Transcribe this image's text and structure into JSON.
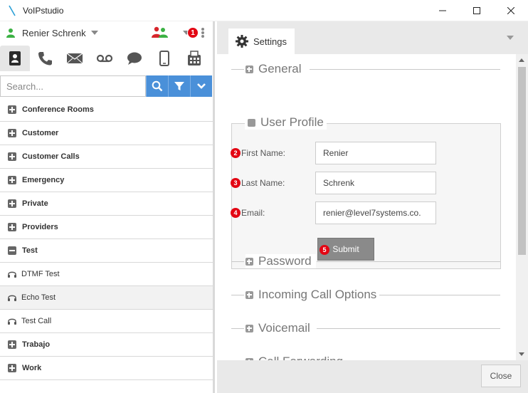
{
  "window": {
    "title": "VoIPstudio",
    "controls": [
      "minimize-icon",
      "maximize-icon",
      "close-icon"
    ]
  },
  "user": {
    "name": "Renier Schrenk",
    "status_color": "#3bb143",
    "notification_count": "1"
  },
  "tabs": [
    {
      "icon": "contacts-icon",
      "active": true
    },
    {
      "icon": "phone-icon"
    },
    {
      "icon": "mail-icon"
    },
    {
      "icon": "voicemail-icon"
    },
    {
      "icon": "chat-icon"
    },
    {
      "icon": "mobile-icon"
    },
    {
      "icon": "fax-icon"
    }
  ],
  "search": {
    "placeholder": "Search...",
    "value": ""
  },
  "list": [
    {
      "type": "group",
      "label": "Conference Rooms",
      "expanded": false
    },
    {
      "type": "group",
      "label": "Customer",
      "expanded": false
    },
    {
      "type": "group",
      "label": "Customer Calls",
      "expanded": false
    },
    {
      "type": "group",
      "label": "Emergency",
      "expanded": false
    },
    {
      "type": "group",
      "label": "Private",
      "expanded": false
    },
    {
      "type": "group",
      "label": "Providers",
      "expanded": false
    },
    {
      "type": "group",
      "label": "Test",
      "expanded": true
    },
    {
      "type": "item",
      "label": "DTMF Test"
    },
    {
      "type": "item",
      "label": "Echo Test",
      "highlighted": true
    },
    {
      "type": "item",
      "label": "Test Call"
    },
    {
      "type": "group",
      "label": "Trabajo",
      "expanded": false
    },
    {
      "type": "group",
      "label": "Work",
      "expanded": false
    }
  ],
  "settings": {
    "tab_label": "Settings",
    "sections": {
      "general": "General",
      "user_profile": "User Profile",
      "password": "Password",
      "incoming_call_options": "Incoming Call Options",
      "voicemail": "Voicemail",
      "call_forwarding": "Call Forwarding"
    },
    "form": {
      "first_name_label": "First Name:",
      "first_name_value": "Renier",
      "last_name_label": "Last Name:",
      "last_name_value": "Schrenk",
      "email_label": "Email:",
      "email_value": "renier@level7systems.co.",
      "submit_label": "Submit"
    },
    "markers": [
      "2",
      "3",
      "4",
      "5"
    ]
  },
  "footer": {
    "close_label": "Close"
  },
  "colors": {
    "accent": "#4a90d9",
    "badge": "#e30613",
    "status_online": "#3bb143",
    "group_icon": "#d7262b"
  }
}
